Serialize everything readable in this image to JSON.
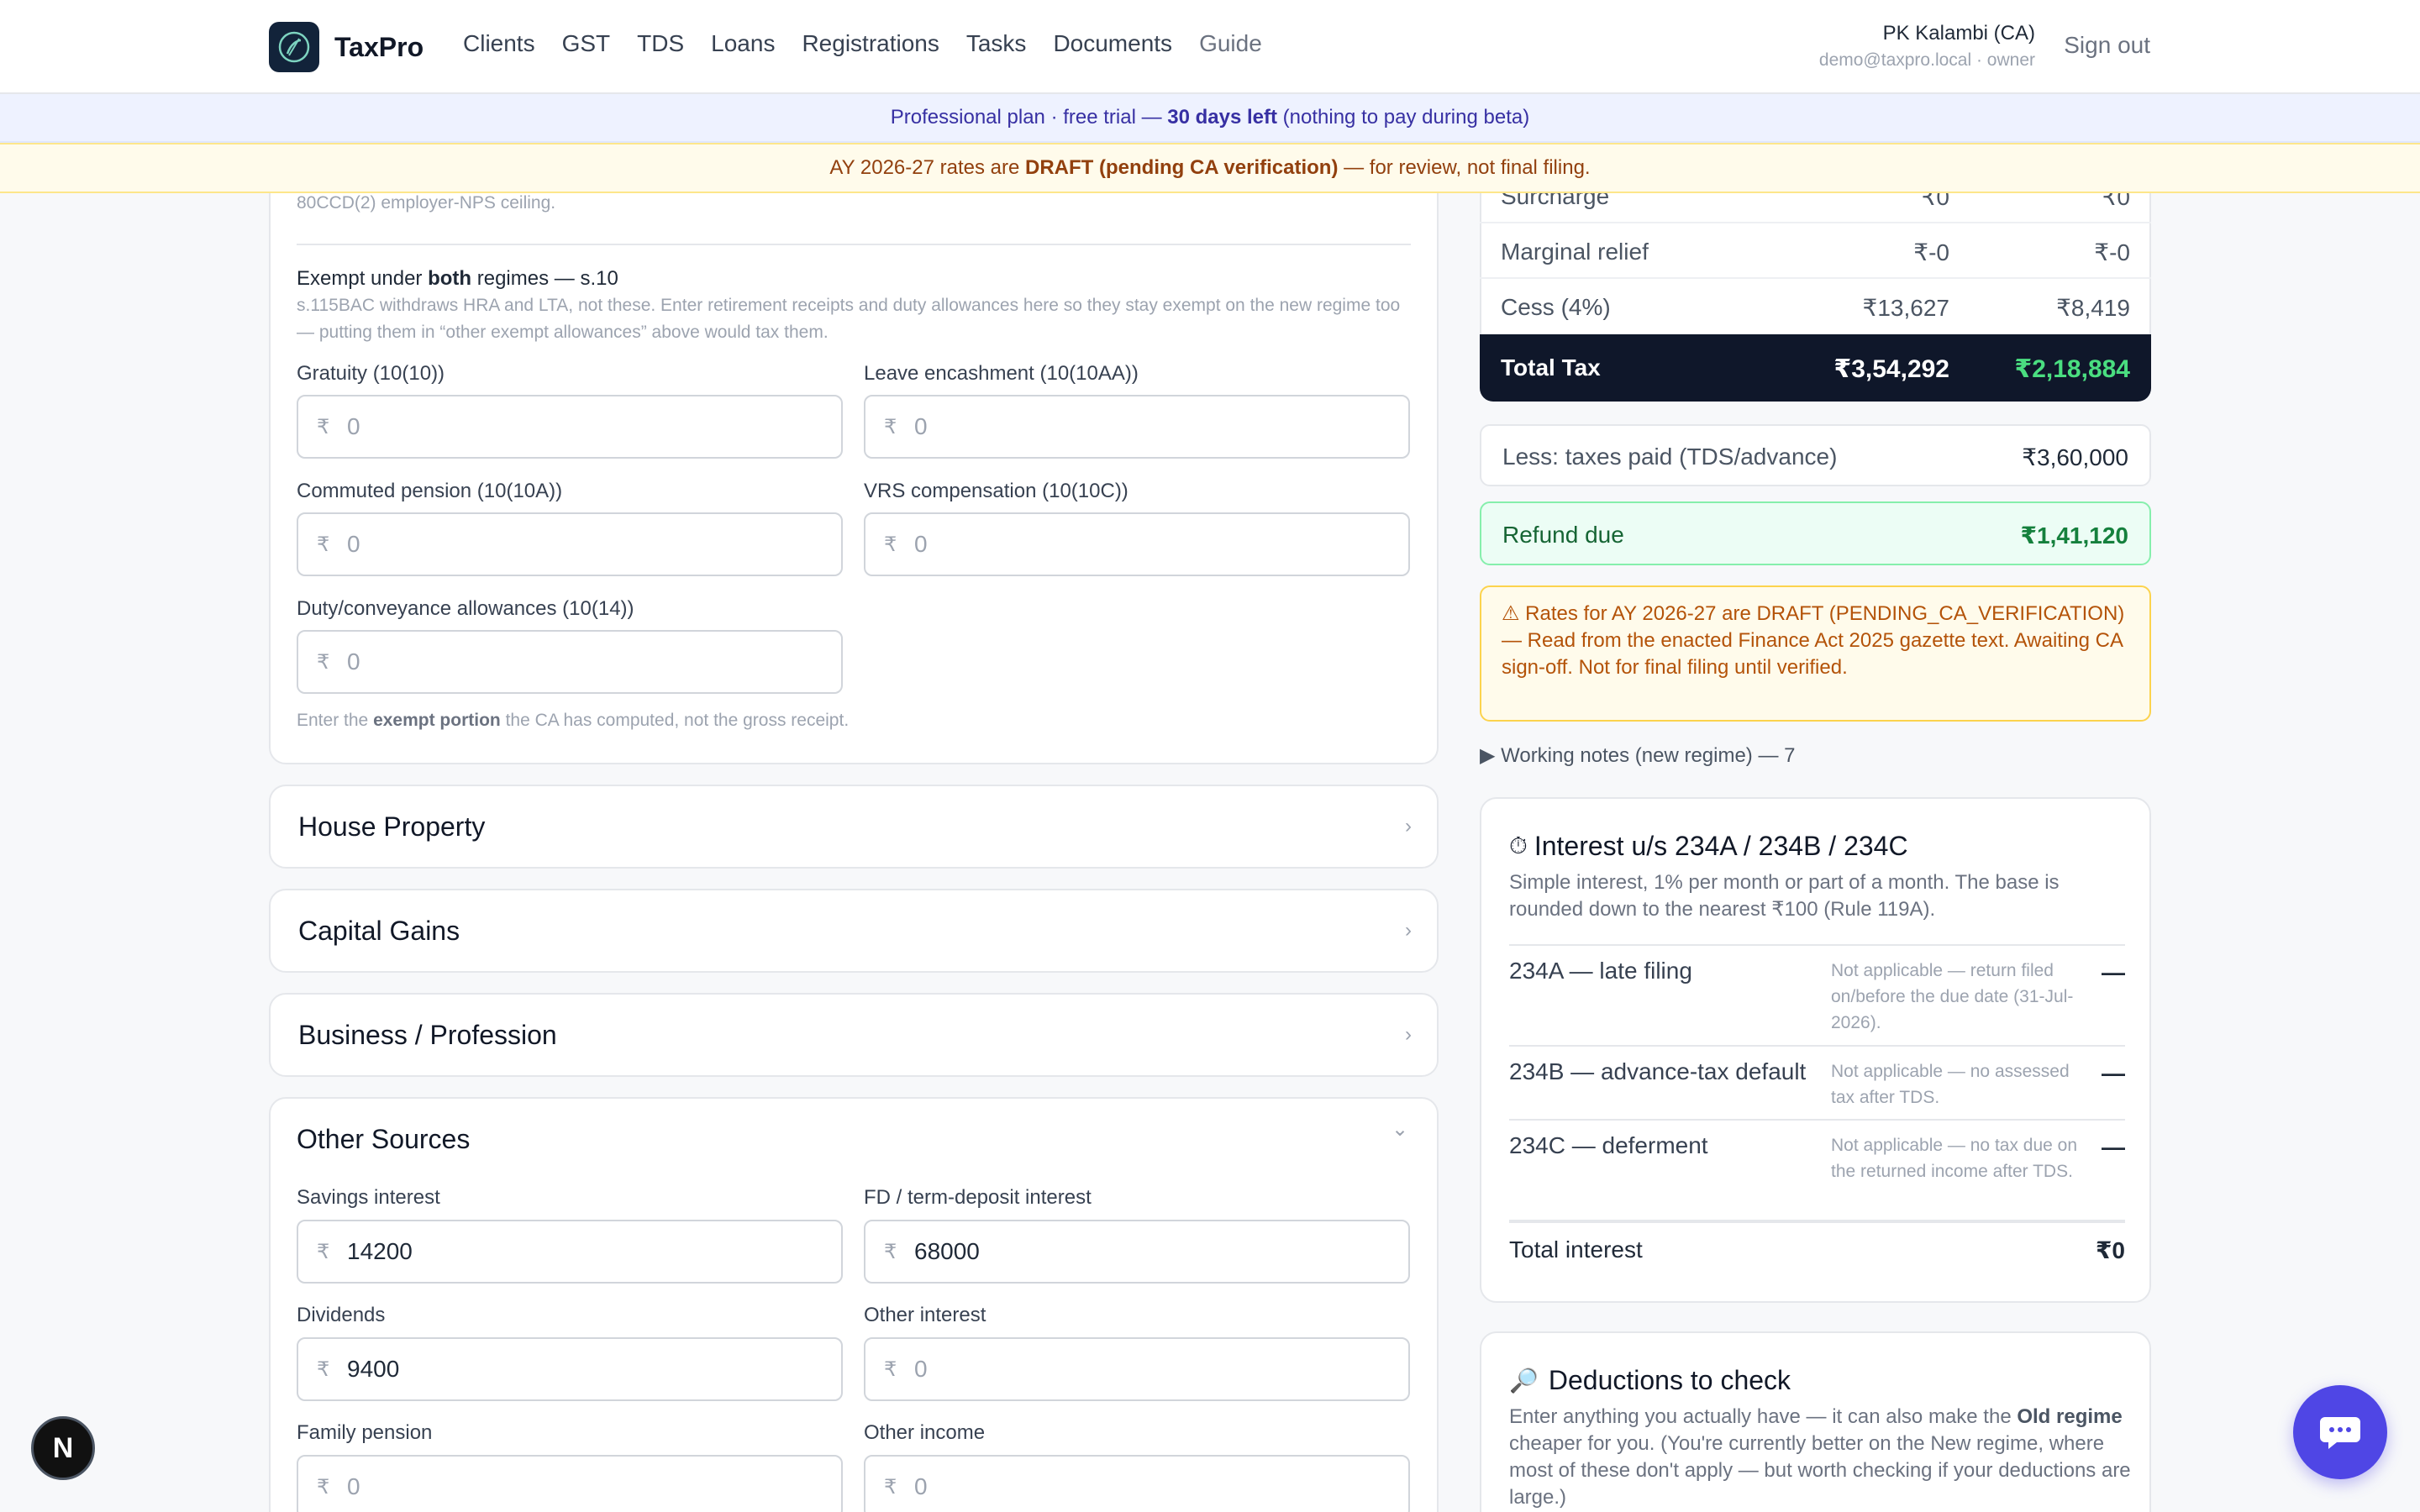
{
  "app": {
    "brand": "TaxPro",
    "nav": [
      "Clients",
      "GST",
      "TDS",
      "Loans",
      "Registrations",
      "Tasks",
      "Documents",
      "Guide"
    ],
    "user_name": "PK Kalambi (CA)",
    "user_sub": "demo@taxpro.local · owner",
    "signout": "Sign out"
  },
  "banners": {
    "plan_pre": "Professional plan · free trial — ",
    "plan_bold": "30 days left",
    "plan_post": " (nothing to pay during beta)",
    "draft_pre": "AY 2026-27 rates are ",
    "draft_bold": "DRAFT (pending CA verification)",
    "draft_post": " — for review, not final filing."
  },
  "salary_card": {
    "faded_top": "80CCD(2) employer-NPS ceiling.",
    "exempt_pre": "Exempt under ",
    "exempt_bold": "both",
    "exempt_post": " regimes — s.10",
    "exempt_note": "s.115BAC withdraws HRA and LTA, not these. Enter retirement receipts and duty allowances here so they stay exempt on the new regime too — putting them in “other exempt allowances” above would tax them.",
    "currency": "₹",
    "fields": [
      {
        "label": "Gratuity (10(10))",
        "value": "",
        "placeholder": "0"
      },
      {
        "label": "Leave encashment (10(10AA))",
        "value": "",
        "placeholder": "0"
      },
      {
        "label": "Commuted pension (10(10A))",
        "value": "",
        "placeholder": "0"
      },
      {
        "label": "VRS compensation (10(10C))",
        "value": "",
        "placeholder": "0"
      },
      {
        "label": "Duty/conveyance allowances (10(14))",
        "value": "",
        "placeholder": "0"
      }
    ],
    "footer_pre": "Enter the ",
    "footer_bold": "exempt portion",
    "footer_post": " the CA has computed, not the gross receipt."
  },
  "sections": [
    {
      "title": "House Property",
      "chevron": "›"
    },
    {
      "title": "Capital Gains",
      "chevron": "›"
    },
    {
      "title": "Business / Profession",
      "chevron": "›"
    }
  ],
  "other_sources": {
    "title": "Other Sources",
    "chevron": "⌄",
    "fields": [
      {
        "label": "Savings interest",
        "value": "14200",
        "placeholder": "0"
      },
      {
        "label": "FD / term-deposit interest",
        "value": "68000",
        "placeholder": "0"
      },
      {
        "label": "Dividends",
        "value": "9400",
        "placeholder": "0"
      },
      {
        "label": "Other interest",
        "value": "",
        "placeholder": "0"
      },
      {
        "label": "Family pension",
        "value": "",
        "placeholder": "0"
      },
      {
        "label": "Other income",
        "value": "",
        "placeholder": "0"
      }
    ]
  },
  "tax_table": {
    "rows": [
      {
        "name": "Surcharge",
        "old": "₹0",
        "new": "₹0"
      },
      {
        "name": "Marginal relief",
        "old": "₹-0",
        "new": "₹-0"
      },
      {
        "name": "Cess (4%)",
        "old": "₹13,627",
        "new": "₹8,419"
      }
    ],
    "total": {
      "name": "Total Tax",
      "old": "₹3,54,292",
      "new": "₹2,18,884"
    },
    "paid": {
      "name": "Less: taxes paid (TDS/advance)",
      "value": "₹3,60,000"
    },
    "refund": {
      "name": "Refund due",
      "value": "₹1,41,120"
    },
    "warning": "⚠ Rates for AY 2026-27 are DRAFT (PENDING_CA_VERIFICATION) — Read from the enacted Finance Act 2025 gazette text. Awaiting CA sign-off. Not for final filing until verified.",
    "notes": "▶ Working notes (new regime) — 7"
  },
  "interest": {
    "icon": "⏱",
    "title": "Interest u/s 234A / 234B / 234C",
    "desc": "Simple interest, 1% per month or part of a month. The base is rounded down to the nearest ₹100 (Rule 119A).",
    "rows": [
      {
        "name": "234A — late filing",
        "detail": "Not applicable — return filed on/before the due date (31-Jul-2026).",
        "value": "—"
      },
      {
        "name": "234B — advance-tax default",
        "detail": "Not applicable — no assessed tax after TDS.",
        "value": "—"
      },
      {
        "name": "234C — deferment",
        "detail": "Not applicable — no tax due on the returned income after TDS.",
        "value": "—"
      }
    ],
    "total_label": "Total interest",
    "total_value": "₹0"
  },
  "deductions": {
    "icon": "🔎",
    "title": "Deductions to check",
    "desc_pre": "Enter anything you actually have — it can also make the ",
    "desc_bold": "Old regime",
    "desc_post": " cheaper for you. (You're currently better on the New regime, where most of these don't apply — but worth checking if your deductions are large.)"
  },
  "badge": "N",
  "colors": {
    "accent": "#4f46e5",
    "dark": "#0f172a",
    "green": "#4ade80",
    "warn": "#b45309"
  }
}
